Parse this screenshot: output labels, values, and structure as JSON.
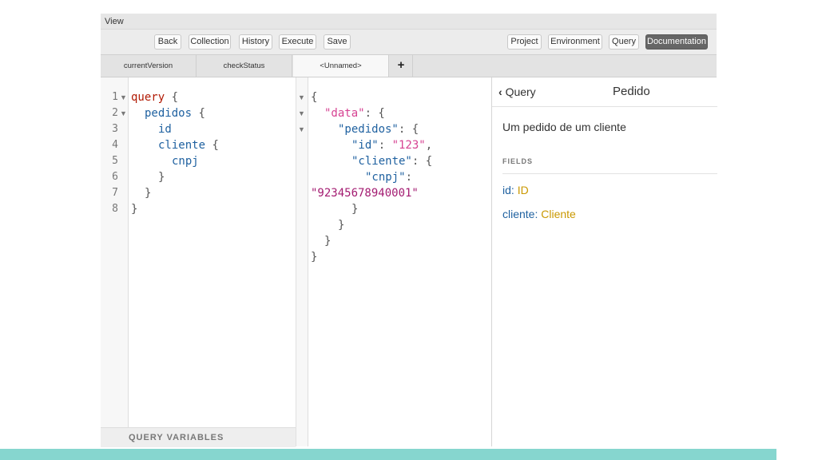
{
  "menubar": {
    "view_label": "View"
  },
  "toolbar": {
    "left_buttons": [
      "Back",
      "Collection",
      "History",
      "Execute",
      "Save"
    ],
    "right_buttons": [
      "Project",
      "Environment",
      "Query",
      "Documentation"
    ],
    "active_button": "Documentation"
  },
  "tabs": {
    "items": [
      "currentVersion",
      "checkStatus",
      "<Unnamed>"
    ],
    "active": "<Unnamed>",
    "add_label": "+"
  },
  "query_editor": {
    "line_numbers": [
      "1",
      "2",
      "3",
      "4",
      "5",
      "6",
      "7",
      "8"
    ],
    "keyword": "query",
    "fields": [
      "pedidos",
      "id",
      "cliente",
      "cnpj"
    ],
    "braces": [
      "{",
      "{",
      "{",
      "}",
      "}",
      "}"
    ]
  },
  "query_variables_label": "QUERY VARIABLES",
  "result": {
    "keys": [
      "\"data\"",
      "\"pedidos\"",
      "\"id\"",
      "\"cliente\"",
      "\"cnpj\""
    ],
    "values": {
      "id": "\"123\"",
      "cnpj": "\"92345678940001\""
    }
  },
  "docs": {
    "back_label": "Query",
    "title": "Pedido",
    "description": "Um pedido de um cliente",
    "fields_label": "FIELDS",
    "fields": [
      {
        "name": "id",
        "type": "ID"
      },
      {
        "name": "cliente",
        "type": "Cliente"
      }
    ]
  },
  "colors": {
    "accent_strip": "#86d6cf",
    "keyword": "#b11a04",
    "field": "#1f61a0",
    "string": "#d64292",
    "type": "#ca9800",
    "active_button": "#666666"
  }
}
